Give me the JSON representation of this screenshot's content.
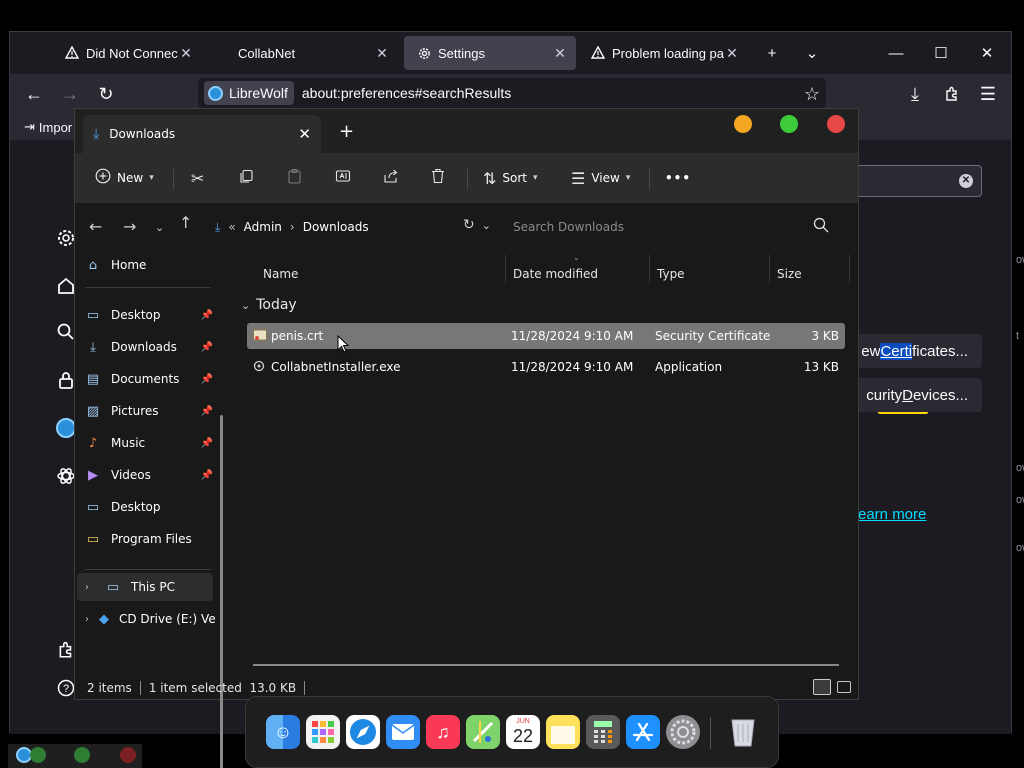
{
  "browser": {
    "tabs": [
      {
        "label": "Did Not Connect: Pot",
        "icon": "warning-icon"
      },
      {
        "label": "CollabNet",
        "icon": ""
      },
      {
        "label": "Settings",
        "icon": "gear-icon"
      },
      {
        "label": "Problem loading page",
        "icon": "warning-icon"
      }
    ],
    "new_tab": "+",
    "tab_list": "⌄",
    "window_controls": {
      "minimize": "—",
      "maximize": "☐",
      "close": "✕"
    },
    "nav": {
      "back": "←",
      "forward": "→",
      "reload": "↻"
    },
    "identity_label": "LibreWolf",
    "url": "about:preferences#searchResults",
    "bookmark_label": "Impor",
    "prefs": {
      "view_certificates": "ew Certificates...",
      "view_cert_prefix": "ew ",
      "view_cert_match": "Certi",
      "view_cert_suffix": "ficates...",
      "security_devices": "curity Devices...",
      "security_devices_prefix": "curity ",
      "security_devices_match": "D",
      "security_devices_suffix": "evices...",
      "learn_more": "earn more",
      "tooltip": "certi",
      "find_clear": "✕"
    },
    "clipped_right": [
      "ow",
      "t",
      "ow",
      "ow",
      "ow"
    ]
  },
  "explorer": {
    "tab_label": "Downloads",
    "toolbar": {
      "new_label": "New",
      "sort_label": "Sort",
      "view_label": "View",
      "more_label": "•••"
    },
    "breadcrumb": {
      "overflow": "«",
      "items": [
        "Admin",
        "Downloads"
      ],
      "sep": "›"
    },
    "search_placeholder": "Search Downloads",
    "nav_items": [
      {
        "label": "Home",
        "icon": "home-icon",
        "pinned": false
      },
      {
        "label": "Desktop",
        "icon": "desktop-icon",
        "pinned": true
      },
      {
        "label": "Downloads",
        "icon": "downloads-icon",
        "pinned": true
      },
      {
        "label": "Documents",
        "icon": "documents-icon",
        "pinned": true
      },
      {
        "label": "Pictures",
        "icon": "pictures-icon",
        "pinned": true
      },
      {
        "label": "Music",
        "icon": "music-icon",
        "pinned": true
      },
      {
        "label": "Videos",
        "icon": "videos-icon",
        "pinned": true
      },
      {
        "label": "Desktop",
        "icon": "folder-icon",
        "pinned": false
      },
      {
        "label": "Program Files",
        "icon": "folder-icon",
        "pinned": false
      },
      {
        "label": "This PC",
        "icon": "computer-icon",
        "pinned": false
      },
      {
        "label": "CD Drive (E:) Ver",
        "icon": "cd-drive-icon",
        "pinned": false
      }
    ],
    "columns": [
      "Name",
      "Date modified",
      "Type",
      "Size"
    ],
    "group": "Today",
    "files": [
      {
        "name": "penis.crt",
        "date": "11/28/2024 9:10 AM",
        "type": "Security Certificate",
        "size": "3 KB",
        "selected": true
      },
      {
        "name": "CollabnetInstaller.exe",
        "date": "11/28/2024 9:10 AM",
        "type": "Application",
        "size": "13 KB",
        "selected": false
      }
    ],
    "status": {
      "count": "2 items",
      "selection": "1 item selected  13.0 KB"
    }
  },
  "dock": {
    "apps": [
      "finder-icon",
      "launchpad-icon",
      "safari-icon",
      "mail-icon",
      "music-icon",
      "maps-icon",
      "calendar-icon",
      "notes-icon",
      "calculator-icon",
      "app-store-icon",
      "system-settings-icon",
      "trash-icon"
    ],
    "calendar_month": "JUN",
    "calendar_day": "22"
  },
  "colors": {
    "accent": "#0a84ff",
    "traffic_yellow": "#f5a623",
    "traffic_green": "#3ecb3a",
    "traffic_red": "#e64848",
    "selection": "#777777"
  }
}
